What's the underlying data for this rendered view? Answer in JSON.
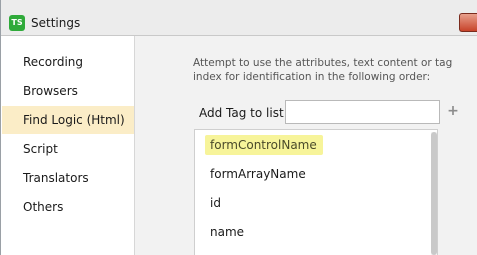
{
  "window": {
    "title": "Settings",
    "app_icon_text": "TS"
  },
  "sidebar": {
    "items": [
      {
        "label": "Recording"
      },
      {
        "label": "Browsers"
      },
      {
        "label": "Find Logic (Html)",
        "selected": true
      },
      {
        "label": "Script"
      },
      {
        "label": "Translators"
      },
      {
        "label": "Others"
      }
    ]
  },
  "find_logic": {
    "description": "Attempt to use the attributes, text content or tag index for identification in the following order:",
    "add_tag_label": "Add Tag to list:",
    "add_tag_value": "",
    "add_icon": "plus-icon",
    "tags": [
      {
        "label": "formControlName",
        "highlighted": true
      },
      {
        "label": "formArrayName"
      },
      {
        "label": "id"
      },
      {
        "label": "name"
      }
    ]
  },
  "colors": {
    "selected_nav_bg": "#fbedc7",
    "highlight": "#f7f49a",
    "close_button": "#c7432a",
    "app_icon": "#2faa3a"
  }
}
